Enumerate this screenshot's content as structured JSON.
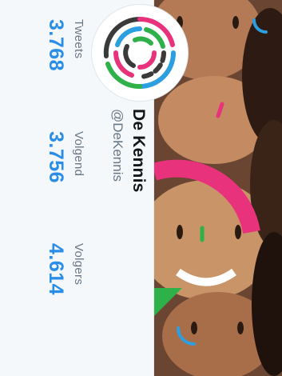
{
  "profile": {
    "name": "De Kennis",
    "handle": "@DeKennis"
  },
  "stats": [
    {
      "label": "Tweets",
      "value": "3.768"
    },
    {
      "label": "Volgend",
      "value": "3.756"
    },
    {
      "label": "Volgers",
      "value": "4.614"
    }
  ],
  "colors": {
    "accent": "#2a8ee8",
    "logo_pink": "#e8327c",
    "logo_blue": "#2c9fe0",
    "logo_green": "#2fb14a",
    "logo_dark": "#3a3a3a"
  },
  "icons": {
    "avatar": "de-kennis-logo-icon"
  }
}
